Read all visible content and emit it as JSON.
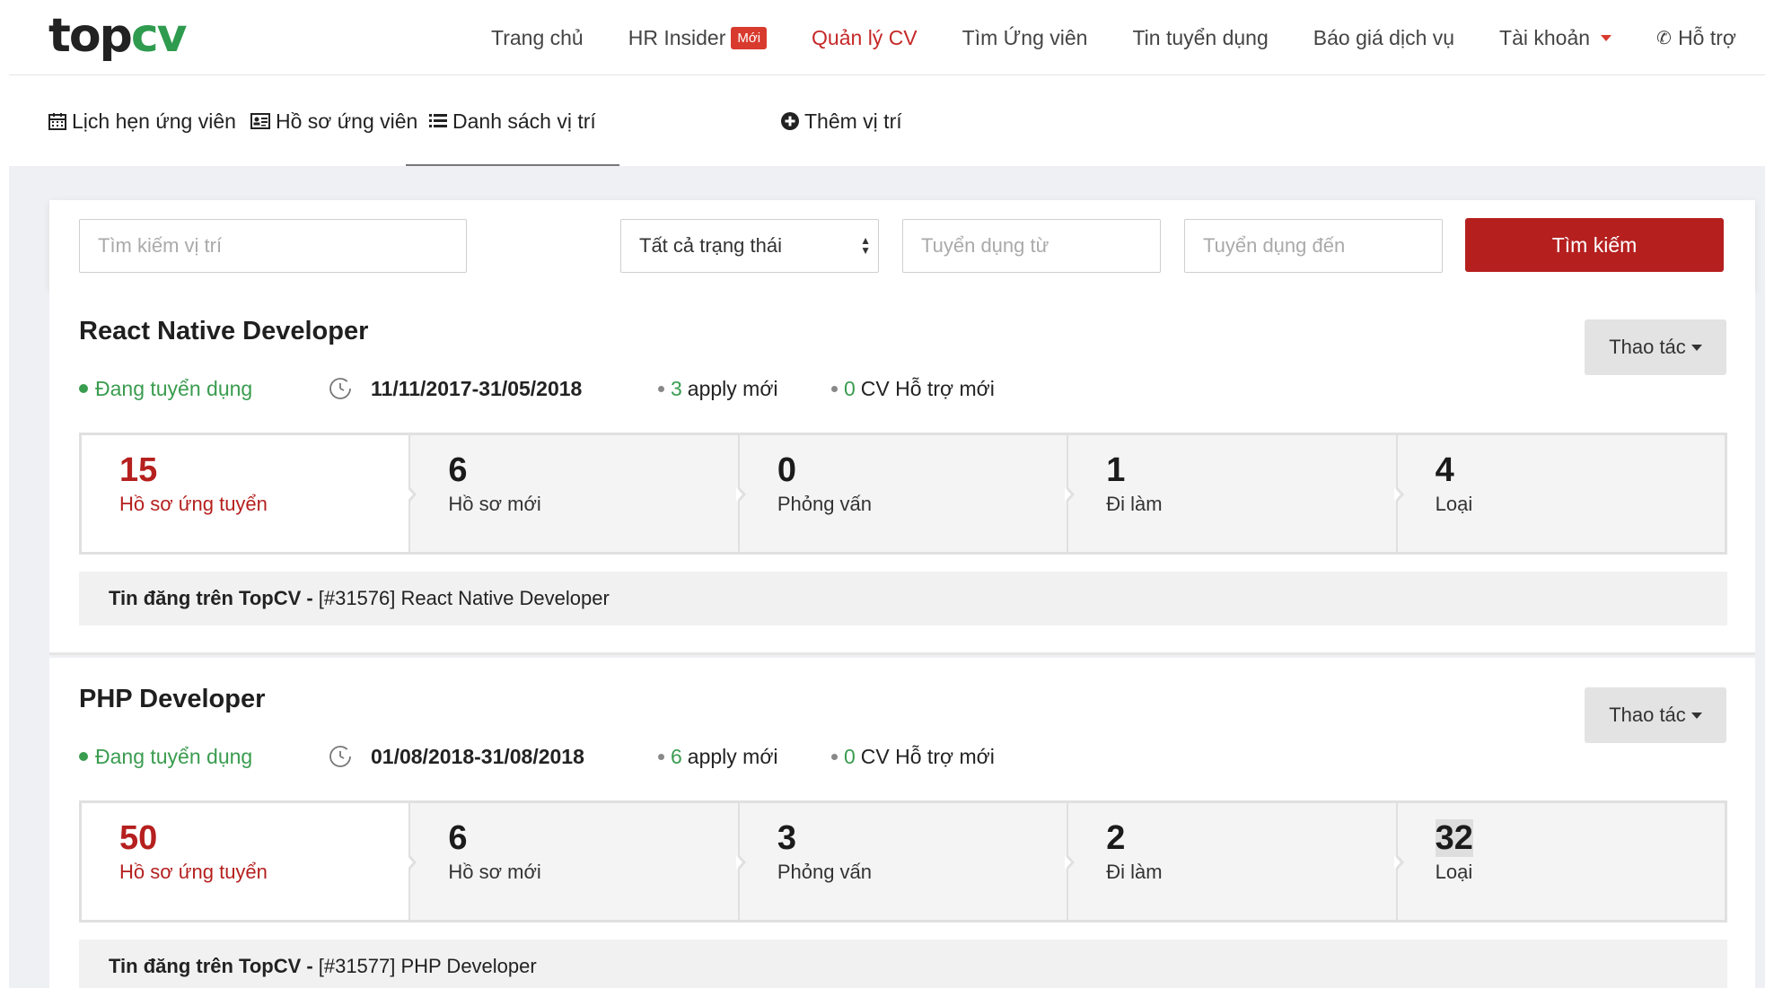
{
  "brand": {
    "logo_part1": "top",
    "logo_part2": "cv"
  },
  "nav": {
    "home": "Trang chủ",
    "hr_insider": "HR Insider",
    "hr_badge": "Mới",
    "manage_cv": "Quản lý CV",
    "find_candidates": "Tìm Ứng viên",
    "job_posts": "Tin tuyển dụng",
    "pricing": "Báo giá dịch vụ",
    "account": "Tài khoản",
    "support": "Hỗ trợ"
  },
  "subnav": {
    "schedule": "Lịch hẹn ứng viên",
    "profiles": "Hồ sơ ứng viên",
    "positions": "Danh sách vị trí",
    "add_position": "Thêm vị trí"
  },
  "search": {
    "position_placeholder": "Tìm kiếm vị trí",
    "status_value": "Tất cả trạng thái",
    "from_placeholder": "Tuyển dụng từ",
    "to_placeholder": "Tuyển dụng đến",
    "button": "Tìm kiếm"
  },
  "jobs": [
    {
      "title": "React Native Developer",
      "action": "Thao tác",
      "status": "Đang tuyển dụng",
      "dates": "11/11/2017-31/05/2018",
      "apply_count": "3",
      "apply_label": "apply mới",
      "cv_count": "0",
      "cv_label": "CV Hỗ trợ mới",
      "stats": [
        {
          "n": "15",
          "l": "Hồ sơ ứng tuyển"
        },
        {
          "n": "6",
          "l": "Hồ sơ mới"
        },
        {
          "n": "0",
          "l": "Phỏng vấn"
        },
        {
          "n": "1",
          "l": "Đi làm"
        },
        {
          "n": "4",
          "l": "Loại"
        }
      ],
      "source_bold": "Tin đăng trên TopCV -",
      "source_text": "[#31576] React Native Developer"
    },
    {
      "title": "PHP Developer",
      "action": "Thao tác",
      "status": "Đang tuyển dụng",
      "dates": "01/08/2018-31/08/2018",
      "apply_count": "6",
      "apply_label": "apply mới",
      "cv_count": "0",
      "cv_label": "CV Hỗ trợ mới",
      "stats": [
        {
          "n": "50",
          "l": "Hồ sơ ứng tuyển"
        },
        {
          "n": "6",
          "l": "Hồ sơ mới"
        },
        {
          "n": "3",
          "l": "Phỏng vấn"
        },
        {
          "n": "2",
          "l": "Đi làm"
        },
        {
          "n": "32",
          "l": "Loại"
        }
      ],
      "source_bold": "Tin đăng trên TopCV -",
      "source_text": "[#31577] PHP Developer"
    }
  ]
}
